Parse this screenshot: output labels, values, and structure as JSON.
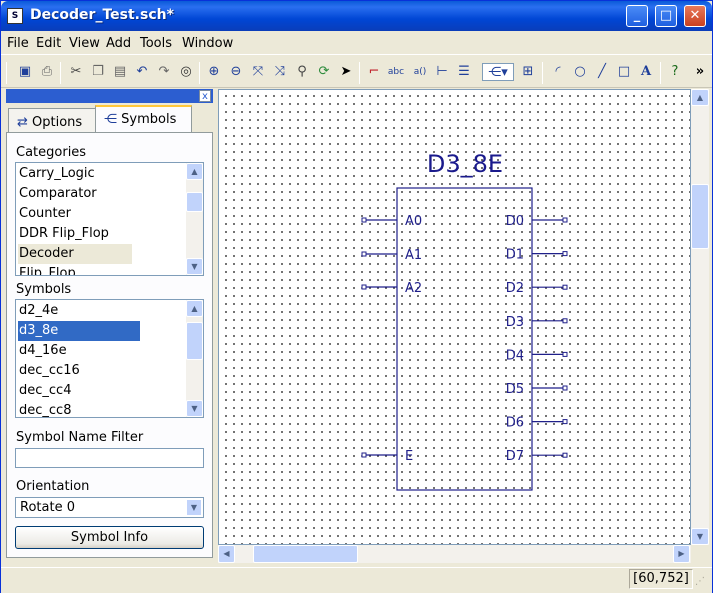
{
  "window": {
    "title": "Decoder_Test.sch*",
    "app_icon": "schematic-doc-icon",
    "controls": [
      "minimize-icon",
      "maximize-icon",
      "close-icon"
    ]
  },
  "menu": [
    "File",
    "Edit",
    "View",
    "Add",
    "Tools",
    "Window"
  ],
  "toolbar": {
    "icons": [
      "save-icon",
      "print-icon",
      "cut-icon",
      "copy-icon",
      "paste-icon",
      "undo-icon",
      "redo-icon",
      "find-icon",
      "zoom-in-icon",
      "zoom-out-icon",
      "zoom-full-icon",
      "zoom-fit-icon",
      "zoom-select-icon",
      "refresh-icon",
      "select-arrow-icon",
      "add-wire-icon",
      "add-net-name-icon",
      "add-io-marker-icon",
      "add-bus-tap-icon",
      "add-bus-icon",
      "add-symbol-icon",
      "add-instance-name-icon",
      "add-arc-icon",
      "add-circle-icon",
      "add-line-icon",
      "add-rectangle-icon",
      "add-text-icon",
      "help-icon"
    ],
    "overflow": "»"
  },
  "panel": {
    "close_glyph": "x",
    "tabs": [
      {
        "label": "Options",
        "icon": "options-icon"
      },
      {
        "label": "Symbols",
        "icon": "symbols-icon"
      }
    ],
    "categories_label": "Categories",
    "categories": [
      "Carry_Logic",
      "Comparator",
      "Counter",
      "DDR Flip_Flop",
      "Decoder",
      "Flip_Flop"
    ],
    "categories_selected": "Decoder",
    "symbols_label": "Symbols",
    "symbols": [
      "d2_4e",
      "d3_8e",
      "d4_16e",
      "dec_cc16",
      "dec_cc4",
      "dec_cc8"
    ],
    "symbols_selected": "d3_8e",
    "filter_label": "Symbol Name Filter",
    "filter_value": "",
    "orientation_label": "Orientation",
    "orientation_value": "Rotate 0",
    "info_button": "Symbol Info"
  },
  "schematic": {
    "symbol_name": "D3_8E",
    "inputs": [
      "A0",
      "A1",
      "A2",
      "E"
    ],
    "outputs": [
      "D0",
      "D1",
      "D2",
      "D3",
      "D4",
      "D5",
      "D6",
      "D7"
    ]
  },
  "status": {
    "coords": "[60,752]"
  },
  "colors": {
    "title_bar": "#0a5bd8",
    "selection": "#316ac5",
    "symbol_text": "#1a1a8c",
    "symbol_outline": "#1f1f8a"
  }
}
